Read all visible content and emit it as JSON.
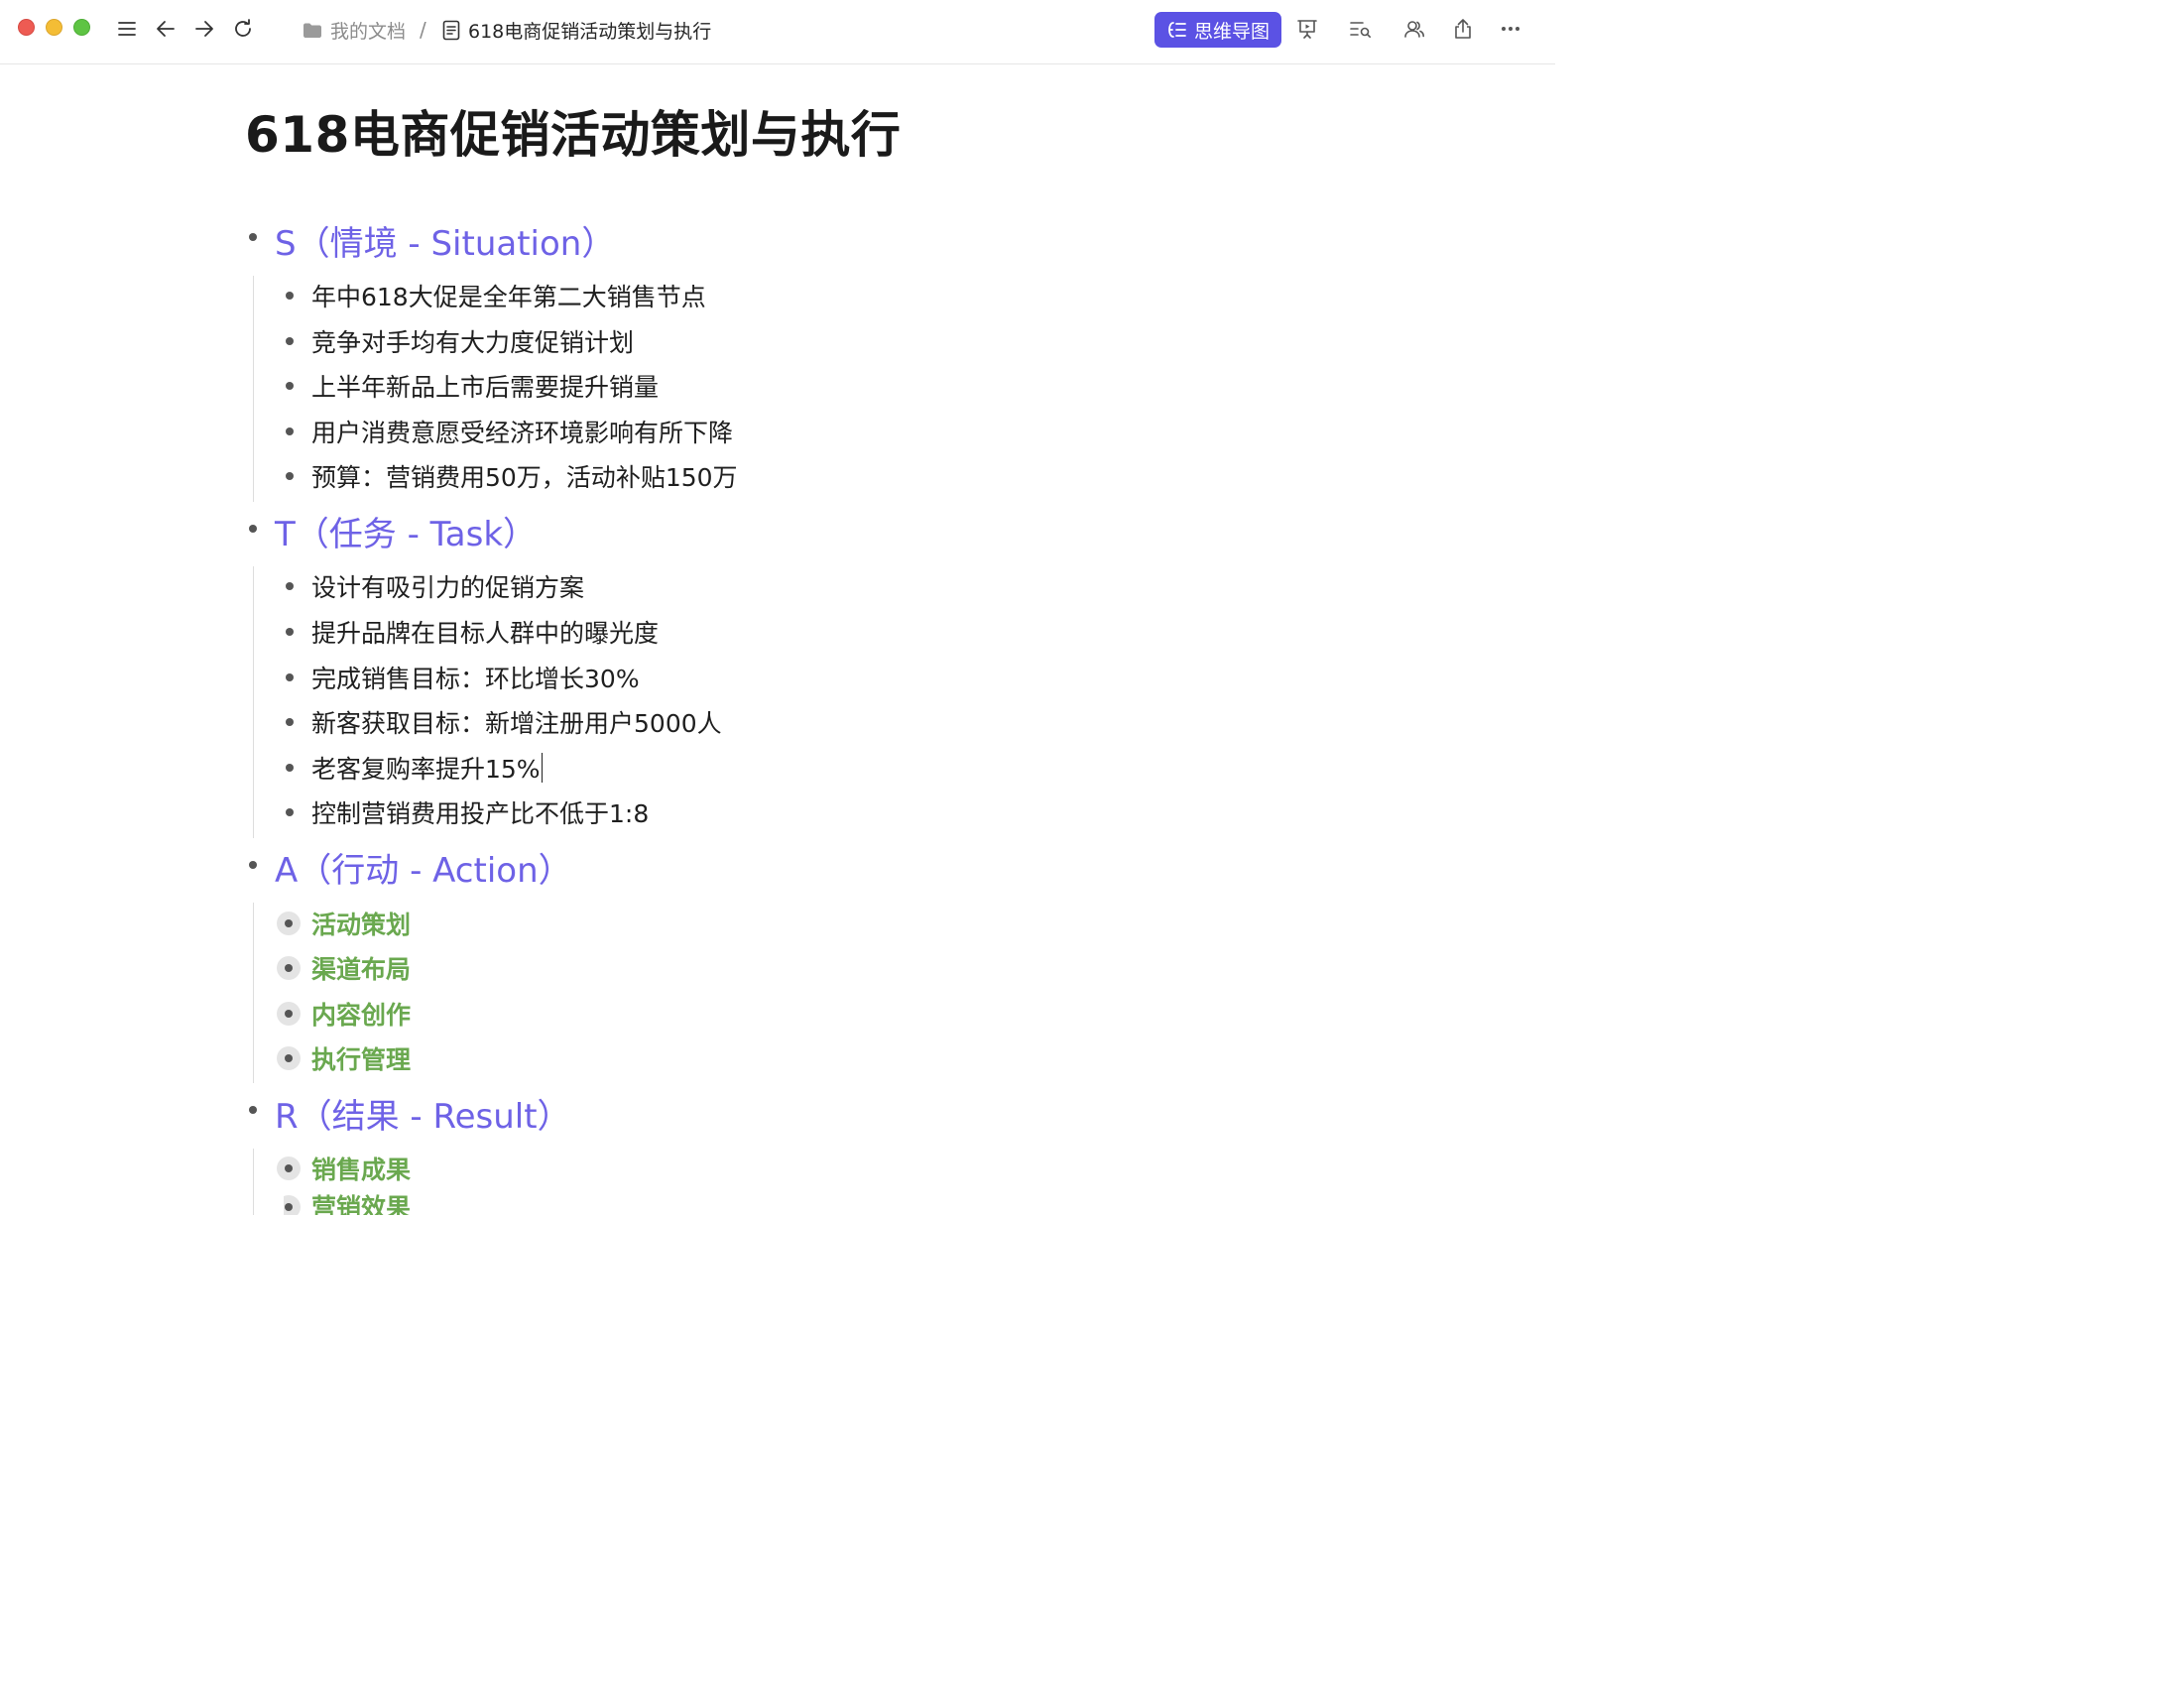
{
  "titlebar": {
    "breadcrumb_folder": "我的文档",
    "breadcrumb_separator": "/",
    "doc_name": "618电商促销活动策划与执行",
    "mindmap_label": "思维导图",
    "accent_color": "#5b52e4",
    "icons": [
      "sidebar-toggle-icon",
      "back-arrow-icon",
      "forward-arrow-icon",
      "refresh-icon",
      "folder-icon",
      "document-icon",
      "mindmap-icon",
      "presentation-icon",
      "outline-search-icon",
      "collaborators-icon",
      "share-icon",
      "more-icon"
    ]
  },
  "doc": {
    "title": "618电商促销活动策划与执行",
    "sections": [
      {
        "heading": "S（情境 - Situation）",
        "items": [
          "年中618大促是全年第二大销售节点",
          "竞争对手均有大力度促销计划",
          "上半年新品上市后需要提升销量",
          "用户消费意愿受经济环境影响有所下降",
          "预算：营销费用50万，活动补贴150万"
        ]
      },
      {
        "heading": "T（任务 - Task）",
        "items": [
          "设计有吸引力的促销方案",
          "提升品牌在目标人群中的曝光度",
          "完成销售目标：环比增长30%",
          "新客获取目标：新增注册用户5000人",
          "老客复购率提升15%",
          "控制营销费用投产比不低于1:8"
        ]
      },
      {
        "heading": "A（行动 - Action）",
        "items": [
          "活动策划",
          "渠道布局",
          "内容创作",
          "执行管理"
        ]
      },
      {
        "heading": "R（结果 - Result）",
        "items": [
          "销售成果",
          "营销效果"
        ]
      }
    ],
    "heading_color": "#6e62e6",
    "collapsed_item_color": "#6aa84f"
  }
}
